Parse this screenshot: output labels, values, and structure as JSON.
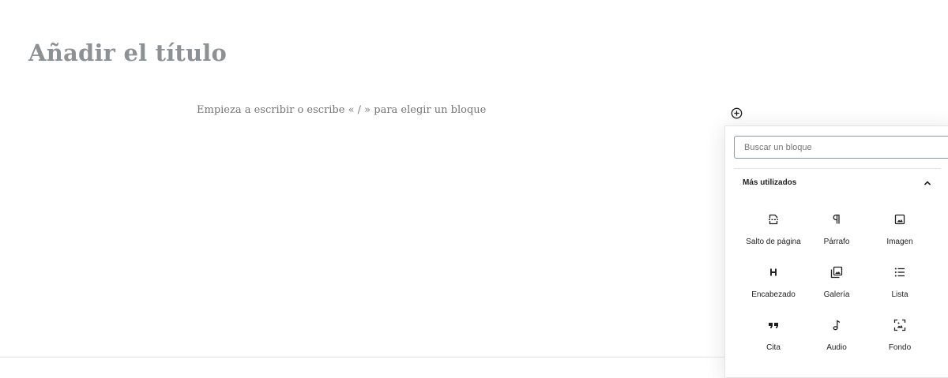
{
  "editor": {
    "title_placeholder": "Añadir el título",
    "block_placeholder": "Empieza a escribir o escribe « / » para elegir un bloque"
  },
  "inserter": {
    "search_placeholder": "Buscar un bloque",
    "panel_title": "Más utilizados",
    "panel_state": "expanded",
    "blocks": [
      {
        "label": "Salto de página",
        "icon": "page-break-icon"
      },
      {
        "label": "Párrafo",
        "icon": "paragraph-icon"
      },
      {
        "label": "Imagen",
        "icon": "image-icon"
      },
      {
        "label": "Encabezado",
        "icon": "heading-icon"
      },
      {
        "label": "Galería",
        "icon": "gallery-icon"
      },
      {
        "label": "Lista",
        "icon": "list-icon"
      },
      {
        "label": "Cita",
        "icon": "quote-icon"
      },
      {
        "label": "Audio",
        "icon": "audio-icon"
      },
      {
        "label": "Fondo",
        "icon": "cover-icon"
      }
    ]
  },
  "colors": {
    "title_placeholder": "#8c9196",
    "text": "#1e1e1e",
    "border": "#e2e4e7"
  }
}
